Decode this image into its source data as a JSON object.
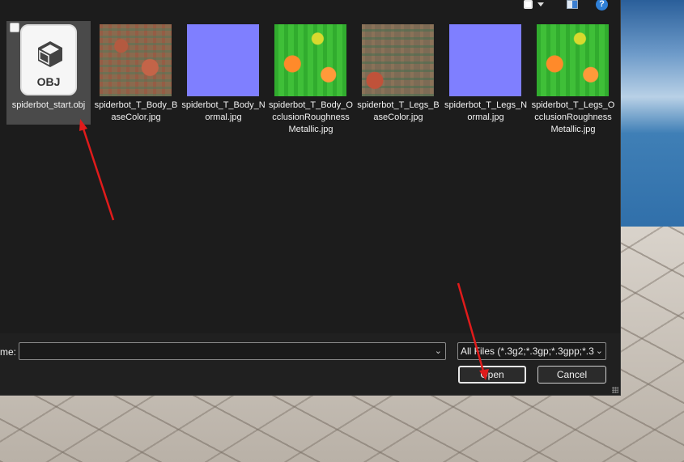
{
  "toolbar": {
    "view_icon": "view-toggle-icon",
    "pane_icon": "preview-pane-icon",
    "help_label": "?"
  },
  "files": [
    {
      "name": "spiderbot_start.obj",
      "kind": "obj",
      "icon_label": "OBJ",
      "selected": true
    },
    {
      "name": "spiderbot_T_Body_BaseColor.jpg",
      "kind": "body-basecolor"
    },
    {
      "name": "spiderbot_T_Body_Normal.jpg",
      "kind": "normal"
    },
    {
      "name": "spiderbot_T_Body_OcclusionRoughnessMetallic.jpg",
      "kind": "orm"
    },
    {
      "name": "spiderbot_T_Legs_BaseColor.jpg",
      "kind": "legs-basecolor"
    },
    {
      "name": "spiderbot_T_Legs_Normal.jpg",
      "kind": "normal"
    },
    {
      "name": "spiderbot_T_Legs_OcclusionRoughnessMetallic.jpg",
      "kind": "orm"
    }
  ],
  "footer": {
    "filename_label": "me:",
    "filename_value": "",
    "filetype_value": "All Files (*.3g2;*.3gp;*.3gpp;*.3g",
    "open_label": "Open",
    "cancel_label": "Cancel"
  },
  "annotation_color": "#e01b1b"
}
